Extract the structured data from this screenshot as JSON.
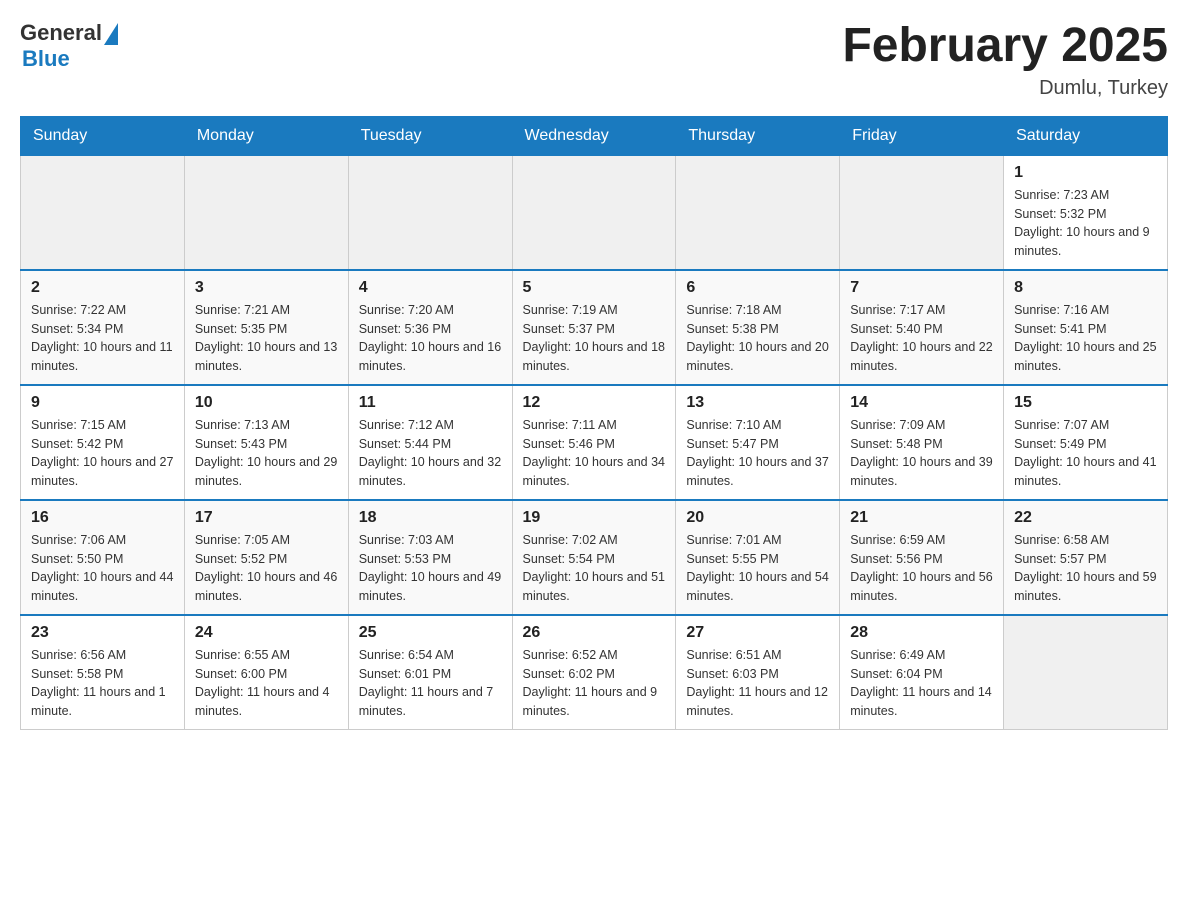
{
  "header": {
    "logo_general": "General",
    "logo_blue": "Blue",
    "title": "February 2025",
    "subtitle": "Dumlu, Turkey"
  },
  "days_of_week": [
    "Sunday",
    "Monday",
    "Tuesday",
    "Wednesday",
    "Thursday",
    "Friday",
    "Saturday"
  ],
  "weeks": [
    {
      "days": [
        {
          "number": "",
          "info": "",
          "empty": true
        },
        {
          "number": "",
          "info": "",
          "empty": true
        },
        {
          "number": "",
          "info": "",
          "empty": true
        },
        {
          "number": "",
          "info": "",
          "empty": true
        },
        {
          "number": "",
          "info": "",
          "empty": true
        },
        {
          "number": "",
          "info": "",
          "empty": true
        },
        {
          "number": "1",
          "info": "Sunrise: 7:23 AM\nSunset: 5:32 PM\nDaylight: 10 hours and 9 minutes.",
          "empty": false
        }
      ]
    },
    {
      "days": [
        {
          "number": "2",
          "info": "Sunrise: 7:22 AM\nSunset: 5:34 PM\nDaylight: 10 hours and 11 minutes.",
          "empty": false
        },
        {
          "number": "3",
          "info": "Sunrise: 7:21 AM\nSunset: 5:35 PM\nDaylight: 10 hours and 13 minutes.",
          "empty": false
        },
        {
          "number": "4",
          "info": "Sunrise: 7:20 AM\nSunset: 5:36 PM\nDaylight: 10 hours and 16 minutes.",
          "empty": false
        },
        {
          "number": "5",
          "info": "Sunrise: 7:19 AM\nSunset: 5:37 PM\nDaylight: 10 hours and 18 minutes.",
          "empty": false
        },
        {
          "number": "6",
          "info": "Sunrise: 7:18 AM\nSunset: 5:38 PM\nDaylight: 10 hours and 20 minutes.",
          "empty": false
        },
        {
          "number": "7",
          "info": "Sunrise: 7:17 AM\nSunset: 5:40 PM\nDaylight: 10 hours and 22 minutes.",
          "empty": false
        },
        {
          "number": "8",
          "info": "Sunrise: 7:16 AM\nSunset: 5:41 PM\nDaylight: 10 hours and 25 minutes.",
          "empty": false
        }
      ]
    },
    {
      "days": [
        {
          "number": "9",
          "info": "Sunrise: 7:15 AM\nSunset: 5:42 PM\nDaylight: 10 hours and 27 minutes.",
          "empty": false
        },
        {
          "number": "10",
          "info": "Sunrise: 7:13 AM\nSunset: 5:43 PM\nDaylight: 10 hours and 29 minutes.",
          "empty": false
        },
        {
          "number": "11",
          "info": "Sunrise: 7:12 AM\nSunset: 5:44 PM\nDaylight: 10 hours and 32 minutes.",
          "empty": false
        },
        {
          "number": "12",
          "info": "Sunrise: 7:11 AM\nSunset: 5:46 PM\nDaylight: 10 hours and 34 minutes.",
          "empty": false
        },
        {
          "number": "13",
          "info": "Sunrise: 7:10 AM\nSunset: 5:47 PM\nDaylight: 10 hours and 37 minutes.",
          "empty": false
        },
        {
          "number": "14",
          "info": "Sunrise: 7:09 AM\nSunset: 5:48 PM\nDaylight: 10 hours and 39 minutes.",
          "empty": false
        },
        {
          "number": "15",
          "info": "Sunrise: 7:07 AM\nSunset: 5:49 PM\nDaylight: 10 hours and 41 minutes.",
          "empty": false
        }
      ]
    },
    {
      "days": [
        {
          "number": "16",
          "info": "Sunrise: 7:06 AM\nSunset: 5:50 PM\nDaylight: 10 hours and 44 minutes.",
          "empty": false
        },
        {
          "number": "17",
          "info": "Sunrise: 7:05 AM\nSunset: 5:52 PM\nDaylight: 10 hours and 46 minutes.",
          "empty": false
        },
        {
          "number": "18",
          "info": "Sunrise: 7:03 AM\nSunset: 5:53 PM\nDaylight: 10 hours and 49 minutes.",
          "empty": false
        },
        {
          "number": "19",
          "info": "Sunrise: 7:02 AM\nSunset: 5:54 PM\nDaylight: 10 hours and 51 minutes.",
          "empty": false
        },
        {
          "number": "20",
          "info": "Sunrise: 7:01 AM\nSunset: 5:55 PM\nDaylight: 10 hours and 54 minutes.",
          "empty": false
        },
        {
          "number": "21",
          "info": "Sunrise: 6:59 AM\nSunset: 5:56 PM\nDaylight: 10 hours and 56 minutes.",
          "empty": false
        },
        {
          "number": "22",
          "info": "Sunrise: 6:58 AM\nSunset: 5:57 PM\nDaylight: 10 hours and 59 minutes.",
          "empty": false
        }
      ]
    },
    {
      "days": [
        {
          "number": "23",
          "info": "Sunrise: 6:56 AM\nSunset: 5:58 PM\nDaylight: 11 hours and 1 minute.",
          "empty": false
        },
        {
          "number": "24",
          "info": "Sunrise: 6:55 AM\nSunset: 6:00 PM\nDaylight: 11 hours and 4 minutes.",
          "empty": false
        },
        {
          "number": "25",
          "info": "Sunrise: 6:54 AM\nSunset: 6:01 PM\nDaylight: 11 hours and 7 minutes.",
          "empty": false
        },
        {
          "number": "26",
          "info": "Sunrise: 6:52 AM\nSunset: 6:02 PM\nDaylight: 11 hours and 9 minutes.",
          "empty": false
        },
        {
          "number": "27",
          "info": "Sunrise: 6:51 AM\nSunset: 6:03 PM\nDaylight: 11 hours and 12 minutes.",
          "empty": false
        },
        {
          "number": "28",
          "info": "Sunrise: 6:49 AM\nSunset: 6:04 PM\nDaylight: 11 hours and 14 minutes.",
          "empty": false
        },
        {
          "number": "",
          "info": "",
          "empty": true
        }
      ]
    }
  ]
}
